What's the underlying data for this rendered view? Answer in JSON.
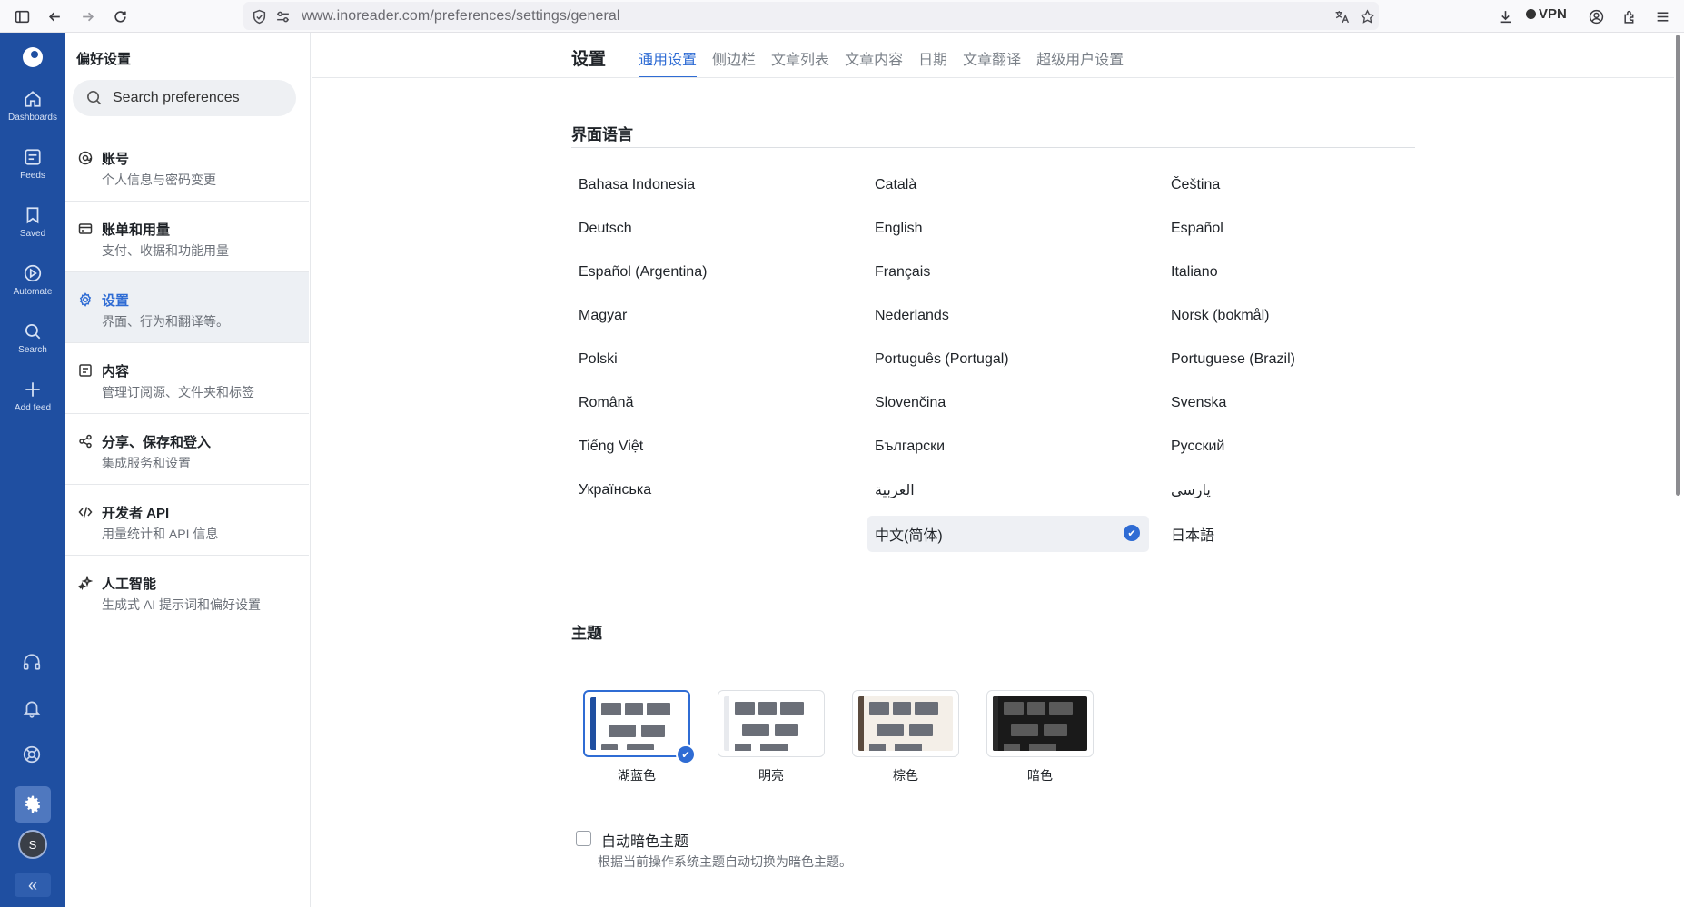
{
  "browser": {
    "url_host": "www.inoreader.com",
    "url_path": "/preferences/settings/general",
    "vpn_label": "VPN"
  },
  "rail": {
    "items": [
      {
        "label": "Dashboards",
        "icon": "home-icon"
      },
      {
        "label": "Feeds",
        "icon": "feeds-icon"
      },
      {
        "label": "Saved",
        "icon": "bookmark-icon"
      },
      {
        "label": "Automate",
        "icon": "automate-icon"
      },
      {
        "label": "Search",
        "icon": "search-icon"
      },
      {
        "label": "Add feed",
        "icon": "plus-icon"
      }
    ],
    "avatar_initial": "S",
    "collapse_glyph": "«"
  },
  "prefs": {
    "title": "偏好设置",
    "search_placeholder": "Search preferences",
    "items": [
      {
        "label": "账号",
        "desc": "个人信息与密码变更"
      },
      {
        "label": "账单和用量",
        "desc": "支付、收据和功能用量"
      },
      {
        "label": "设置",
        "desc": "界面、行为和翻译等。"
      },
      {
        "label": "内容",
        "desc": "管理订阅源、文件夹和标签"
      },
      {
        "label": "分享、保存和登入",
        "desc": "集成服务和设置"
      },
      {
        "label": "开发者 API",
        "desc": "用量统计和 API 信息"
      },
      {
        "label": "人工智能",
        "desc": "生成式 AI 提示词和偏好设置"
      }
    ]
  },
  "main": {
    "title": "设置",
    "tabs": [
      "通用设置",
      "侧边栏",
      "文章列表",
      "文章内容",
      "日期",
      "文章翻译",
      "超级用户设置"
    ],
    "language_section": "界面语言",
    "languages": [
      "Bahasa Indonesia",
      "Català",
      "Čeština",
      "Deutsch",
      "English",
      "Español",
      "Español (Argentina)",
      "Français",
      "Italiano",
      "Magyar",
      "Nederlands",
      "Norsk (bokmål)",
      "Polski",
      "Português (Portugal)",
      "Portuguese (Brazil)",
      "Română",
      "Slovenčina",
      "Svenska",
      "Tiếng Việt",
      "Български",
      "Русский",
      "Українська",
      "العربية",
      "پارسی",
      "",
      "中文(简体)",
      "日本語"
    ],
    "selected_language": "中文(简体)",
    "theme_section": "主题",
    "themes": [
      {
        "label": "湖蓝色",
        "bar": "#1f4fa1",
        "bg": "#ffffff"
      },
      {
        "label": "明亮",
        "bar": "#e8eaee",
        "bg": "#ffffff"
      },
      {
        "label": "棕色",
        "bar": "#5a4a3e",
        "bg": "#f4efe8"
      },
      {
        "label": "暗色",
        "bar": "#2a2a2a",
        "bg": "#1a1a1a"
      }
    ],
    "selected_theme": "湖蓝色",
    "auto_dark_label": "自动暗色主题",
    "auto_dark_desc": "根据当前操作系统主题自动切换为暗色主题。",
    "check_glyph": "✔"
  },
  "colors": {
    "accent": "#2f6cd4",
    "rail": "#1f4fa1"
  }
}
